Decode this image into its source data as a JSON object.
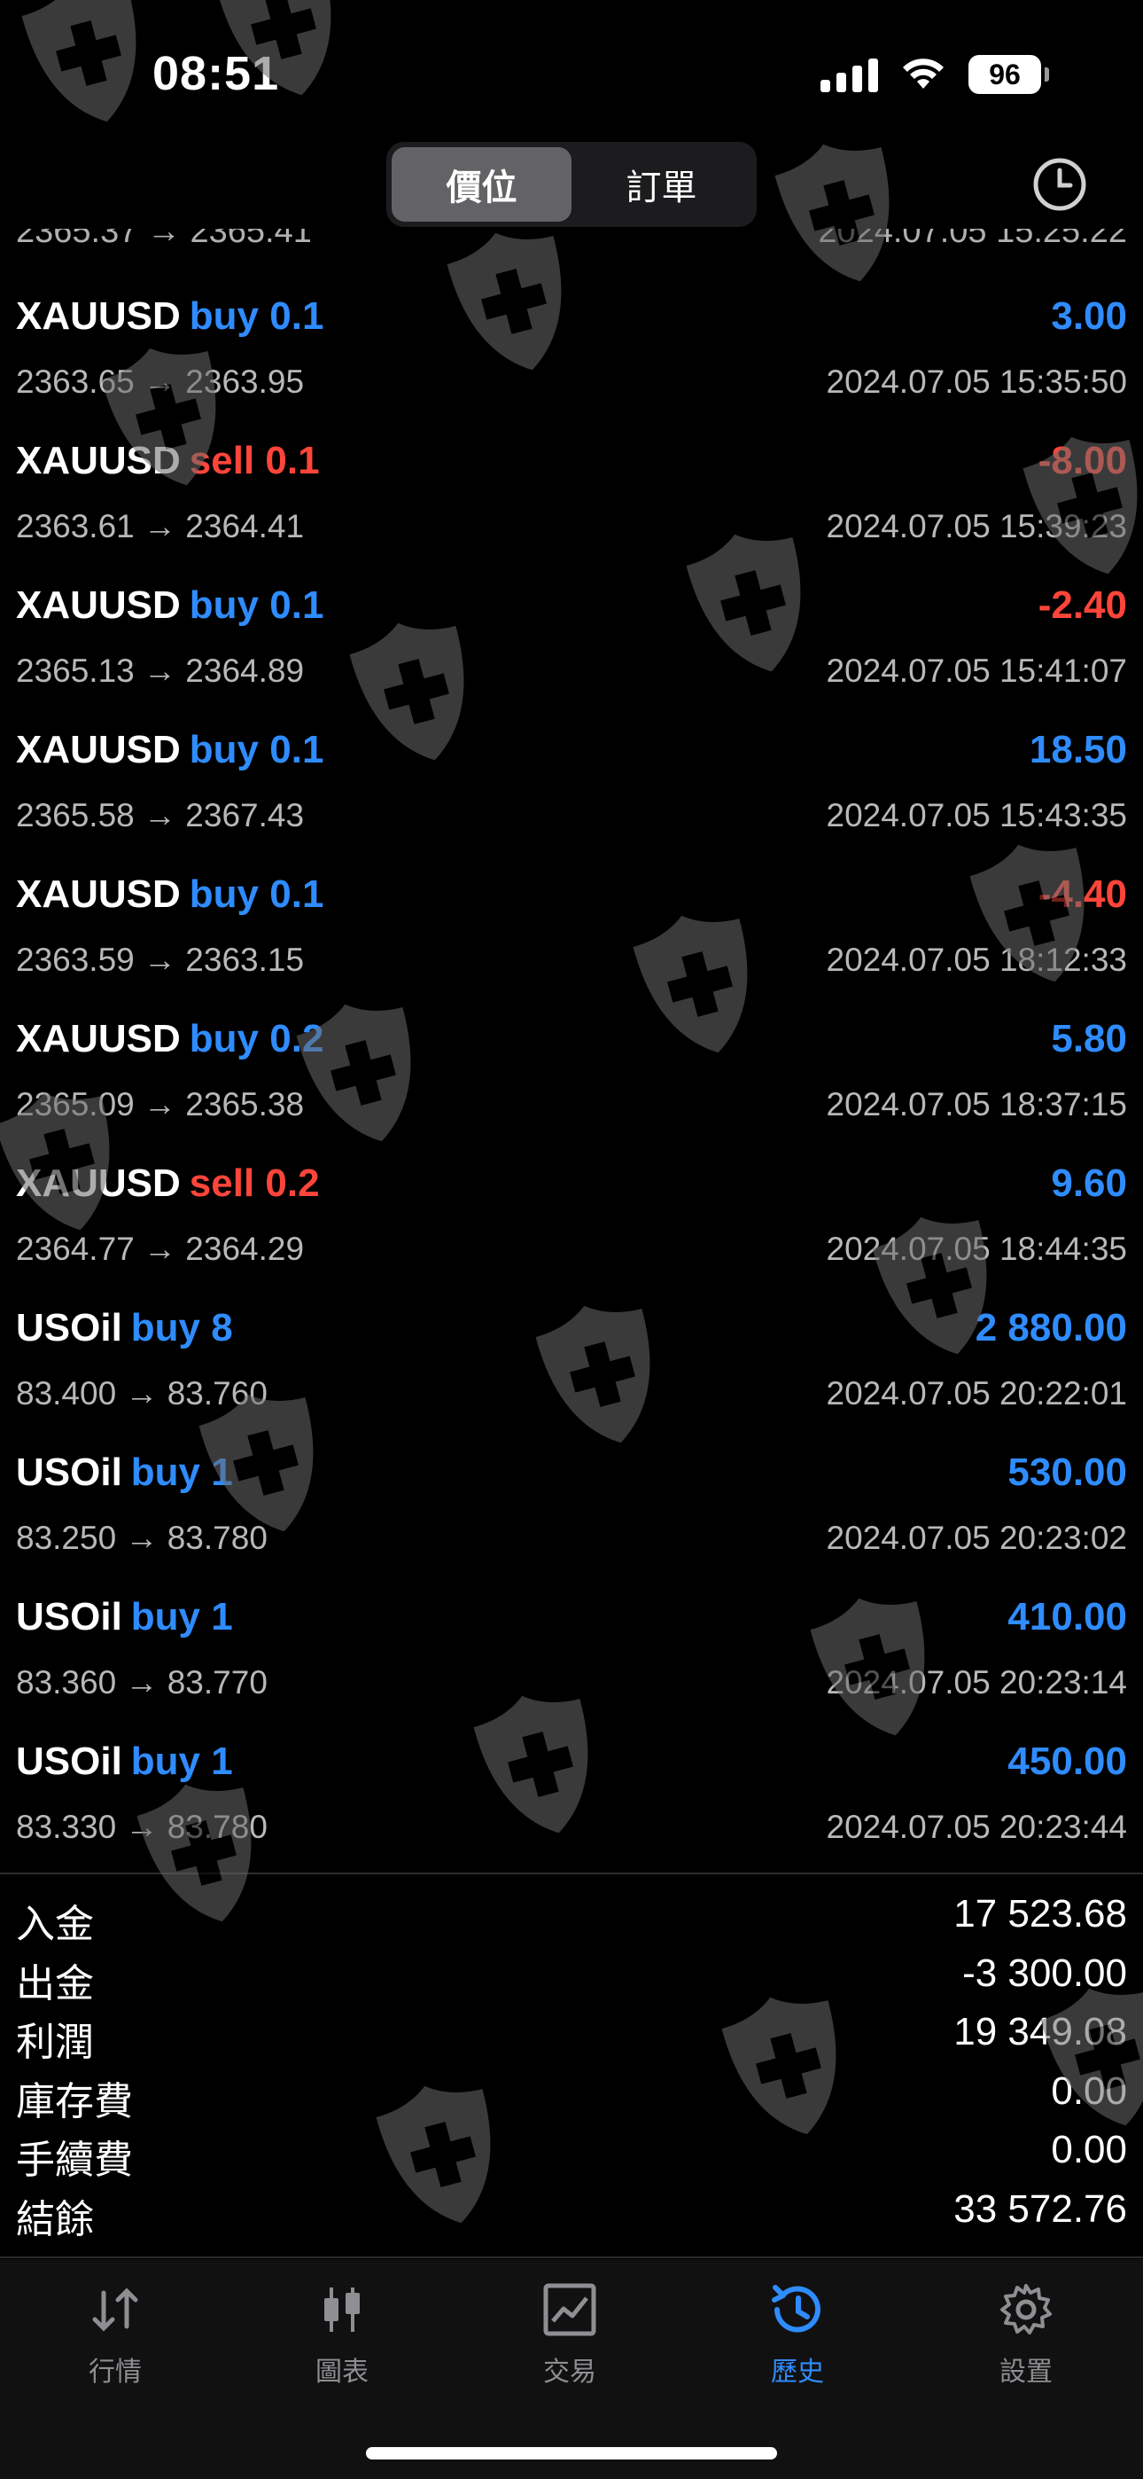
{
  "status_bar": {
    "time": "08:51",
    "battery": "96"
  },
  "segmented": {
    "tabs": [
      "價位",
      "訂單"
    ],
    "active": 0
  },
  "partial_row": {
    "left": "2365.37 → 2365.41",
    "right": "2024.07.05 15:25:22"
  },
  "trades": [
    {
      "symbol": "XAUUSD",
      "side": "buy 0.1",
      "type": "buy",
      "prices": "2363.65 → 2363.95",
      "profit": "3.00",
      "profit_color": "#2f8cff",
      "time": "2024.07.05 15:35:50"
    },
    {
      "symbol": "XAUUSD",
      "side": "sell 0.1",
      "type": "sell",
      "prices": "2363.61 → 2364.41",
      "profit": "-8.00",
      "profit_color": "#ff453a",
      "time": "2024.07.05 15:39:23"
    },
    {
      "symbol": "XAUUSD",
      "side": "buy 0.1",
      "type": "buy",
      "prices": "2365.13 → 2364.89",
      "profit": "-2.40",
      "profit_color": "#ff453a",
      "time": "2024.07.05 15:41:07"
    },
    {
      "symbol": "XAUUSD",
      "side": "buy 0.1",
      "type": "buy",
      "prices": "2365.58 → 2367.43",
      "profit": "18.50",
      "profit_color": "#2f8cff",
      "time": "2024.07.05 15:43:35"
    },
    {
      "symbol": "XAUUSD",
      "side": "buy 0.1",
      "type": "buy",
      "prices": "2363.59 → 2363.15",
      "profit": "-4.40",
      "profit_color": "#ff453a",
      "time": "2024.07.05 18:12:33"
    },
    {
      "symbol": "XAUUSD",
      "side": "buy 0.2",
      "type": "buy",
      "prices": "2365.09 → 2365.38",
      "profit": "5.80",
      "profit_color": "#2f8cff",
      "time": "2024.07.05 18:37:15"
    },
    {
      "symbol": "XAUUSD",
      "side": "sell 0.2",
      "type": "sell",
      "prices": "2364.77 → 2364.29",
      "profit": "9.60",
      "profit_color": "#2f8cff",
      "time": "2024.07.05 18:44:35"
    },
    {
      "symbol": "USOil",
      "side": "buy 8",
      "type": "buy",
      "prices": "83.400 → 83.760",
      "profit": "2 880.00",
      "profit_color": "#2f8cff",
      "time": "2024.07.05 20:22:01"
    },
    {
      "symbol": "USOil",
      "side": "buy 1",
      "type": "buy",
      "prices": "83.250 → 83.780",
      "profit": "530.00",
      "profit_color": "#2f8cff",
      "time": "2024.07.05 20:23:02"
    },
    {
      "symbol": "USOil",
      "side": "buy 1",
      "type": "buy",
      "prices": "83.360 → 83.770",
      "profit": "410.00",
      "profit_color": "#2f8cff",
      "time": "2024.07.05 20:23:14"
    },
    {
      "symbol": "USOil",
      "side": "buy 1",
      "type": "buy",
      "prices": "83.330 → 83.780",
      "profit": "450.00",
      "profit_color": "#2f8cff",
      "time": "2024.07.05 20:23:44"
    }
  ],
  "summary": [
    {
      "label": "入金",
      "value": "17 523.68"
    },
    {
      "label": "出金",
      "value": "-3 300.00"
    },
    {
      "label": "利潤",
      "value": "19 349.08"
    },
    {
      "label": "庫存費",
      "value": "0.00"
    },
    {
      "label": "手續費",
      "value": "0.00"
    },
    {
      "label": "結餘",
      "value": "33 572.76"
    }
  ],
  "tabbar": [
    {
      "label": "行情",
      "icon": "arrows-updown-icon"
    },
    {
      "label": "圖表",
      "icon": "candlestick-icon"
    },
    {
      "label": "交易",
      "icon": "trade-chart-icon"
    },
    {
      "label": "歷史",
      "icon": "history-icon",
      "active": true
    },
    {
      "label": "設置",
      "icon": "gear-icon"
    }
  ],
  "colors": {
    "buy": "#2f8cff",
    "sell": "#ff453a",
    "background": "#000000",
    "muted": "#b8b8b8"
  }
}
